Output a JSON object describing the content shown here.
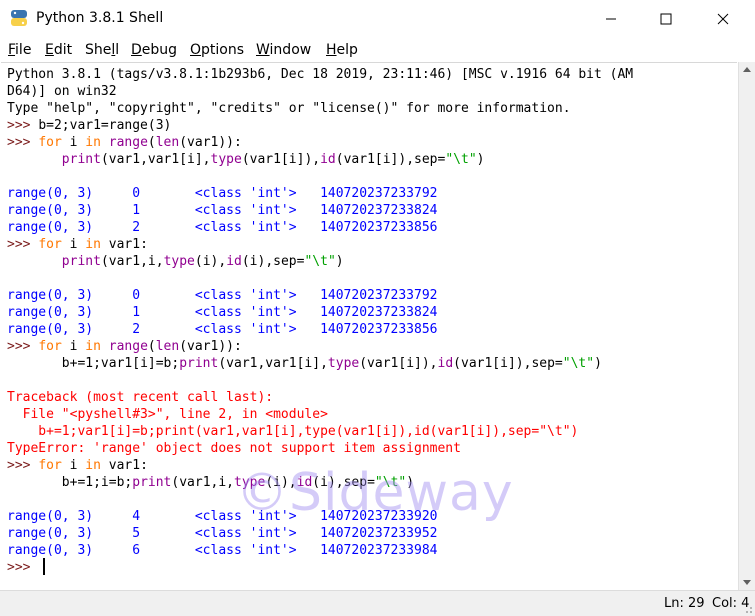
{
  "window": {
    "title": "Python 3.8.1 Shell",
    "app_icon": "python-icon",
    "controls": [
      "minimize-icon",
      "maximize-icon",
      "close-icon"
    ]
  },
  "menu": {
    "file_u": "F",
    "file_rest": "ile",
    "edit_u": "E",
    "edit_rest": "dit",
    "shell_pre": "She",
    "shell_u": "l",
    "shell_rest": "l",
    "debug_u": "D",
    "debug_rest": "ebug",
    "options_u": "O",
    "options_rest": "ptions",
    "window_u": "W",
    "window_rest": "indow",
    "help_u": "H",
    "help_rest": "elp"
  },
  "shell": {
    "banner1": "Python 3.8.1 (tags/v3.8.1:1b293b6, Dec 18 2019, 23:11:46) [MSC v.1916 64 bit (AM",
    "banner2": "D64)] on win32",
    "banner3": "Type \"help\", \"copyright\", \"credits\" or \"license()\" for more information.",
    "prompt": ">>> ",
    "cmd1": "b=2;var1=range(3)",
    "cmd2": {
      "p1": "for",
      "p2": " i ",
      "p3": "in",
      "p4": " ",
      "p5": "range",
      "p6": "(",
      "p7": "len",
      "p8": "(var1)):"
    },
    "cmd2_body": {
      "indent": "       ",
      "f1": "print",
      "a1": "(var1,var1[i],",
      "f2": "type",
      "a2": "(var1[i]),",
      "f3": "id",
      "a3": "(var1[i]),sep=",
      "s": "\"\\t\"",
      "end": ")"
    },
    "out1": [
      "range(0, 3)\t0\t<class 'int'>\t140720237233792",
      "range(0, 3)\t1\t<class 'int'>\t140720237233824",
      "range(0, 3)\t2\t<class 'int'>\t140720237233856"
    ],
    "cmd3": {
      "p1": "for",
      "p2": " i ",
      "p3": "in",
      "p4": " var1:"
    },
    "cmd3_body": {
      "indent": "       ",
      "f1": "print",
      "a1": "(var1,i,",
      "f2": "type",
      "a2": "(i),",
      "f3": "id",
      "a3": "(i),sep=",
      "s": "\"\\t\"",
      "end": ")"
    },
    "out2": [
      "range(0, 3)\t0\t<class 'int'>\t140720237233792",
      "range(0, 3)\t1\t<class 'int'>\t140720237233824",
      "range(0, 3)\t2\t<class 'int'>\t140720237233856"
    ],
    "cmd4": {
      "p1": "for",
      "p2": " i ",
      "p3": "in",
      "p4": " ",
      "p5": "range",
      "p6": "(",
      "p7": "len",
      "p8": "(var1)):"
    },
    "cmd4_body": {
      "indent": "       ",
      "a0": "b+=1;var1[i]=b;",
      "f1": "print",
      "a1": "(var1,var1[i],",
      "f2": "type",
      "a2": "(var1[i]),",
      "f3": "id",
      "a3": "(var1[i]),sep=",
      "s": "\"\\t\"",
      "end": ")"
    },
    "tb1": "Traceback (most recent call last):",
    "tb2": "  File \"<pyshell#3>\", line 2, in <module>",
    "tb3": "    b+=1;var1[i]=b;print(var1,var1[i],type(var1[i]),id(var1[i]),sep=\"\\t\")",
    "tb4": "TypeError: 'range' object does not support item assignment",
    "cmd5": {
      "p1": "for",
      "p2": " i ",
      "p3": "in",
      "p4": " var1:"
    },
    "cmd5_body": {
      "indent": "       ",
      "a0": "b+=1;i=b;",
      "f1": "print",
      "a1": "(var1,i,",
      "f2": "type",
      "a2": "(i),",
      "f3": "id",
      "a3": "(i),sep=",
      "s": "\"\\t\"",
      "end": ")"
    },
    "out3": [
      "range(0, 3)\t4\t<class 'int'>\t140720237233920",
      "range(0, 3)\t5\t<class 'int'>\t140720237233952",
      "range(0, 3)\t6\t<class 'int'>\t140720237233984"
    ],
    "final_prompt": ">>> "
  },
  "watermark": "©Sideway",
  "status": {
    "line": "Ln: 29",
    "col": "Col: 4"
  }
}
